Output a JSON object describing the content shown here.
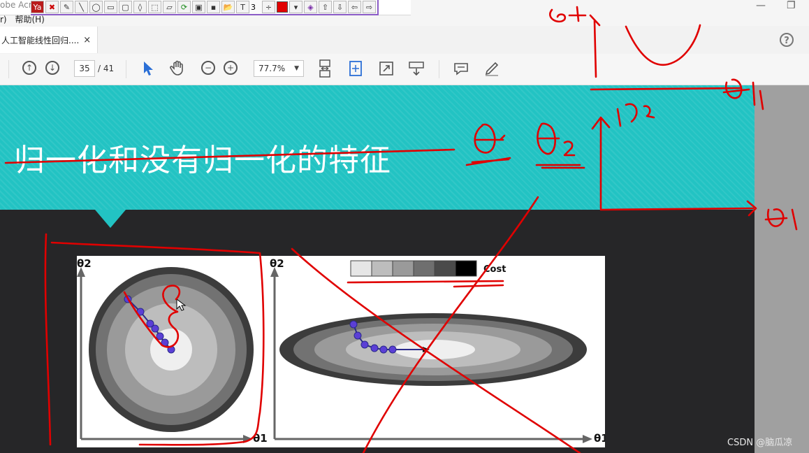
{
  "annotation_toolbar": {
    "app_title_fragment": "obe Acr",
    "line_width": "3",
    "ink_color": "#e00000",
    "tools": [
      "pen-icon",
      "line-icon",
      "ellipse-icon",
      "rectangle-icon",
      "rounded-rect-icon",
      "marker-icon",
      "select-rect-icon",
      "eraser-icon",
      "refresh-icon",
      "window-icon",
      "save-icon",
      "open-icon",
      "text-icon"
    ]
  },
  "menu": {
    "item_fragment": "r)",
    "help": "帮助(H)"
  },
  "tabs": [
    {
      "label": "人工智能线性回归....",
      "close": "×"
    }
  ],
  "help_icon": "?",
  "pdf_toolbar": {
    "page_current": "35",
    "page_total": "/ 41",
    "zoom": "77.7%"
  },
  "slide": {
    "title": "归一化和没有归一化的特征"
  },
  "figure": {
    "left_axis_y": "θ2",
    "left_axis_x": "θ1",
    "right_axis_y": "θ2",
    "right_axis_x": "θ1",
    "legend_label": "Cost",
    "legend_shades": [
      "#e6e6e6",
      "#bdbdbd",
      "#9a9a9a",
      "#6f6f6f",
      "#4a4a4a",
      "#000000"
    ]
  },
  "watermark": "CSDN @脑瓜凉",
  "colors": {
    "teal": "#22c3c3",
    "dark": "#262628",
    "ink": "#e00000",
    "path": "#5b3fd6"
  }
}
